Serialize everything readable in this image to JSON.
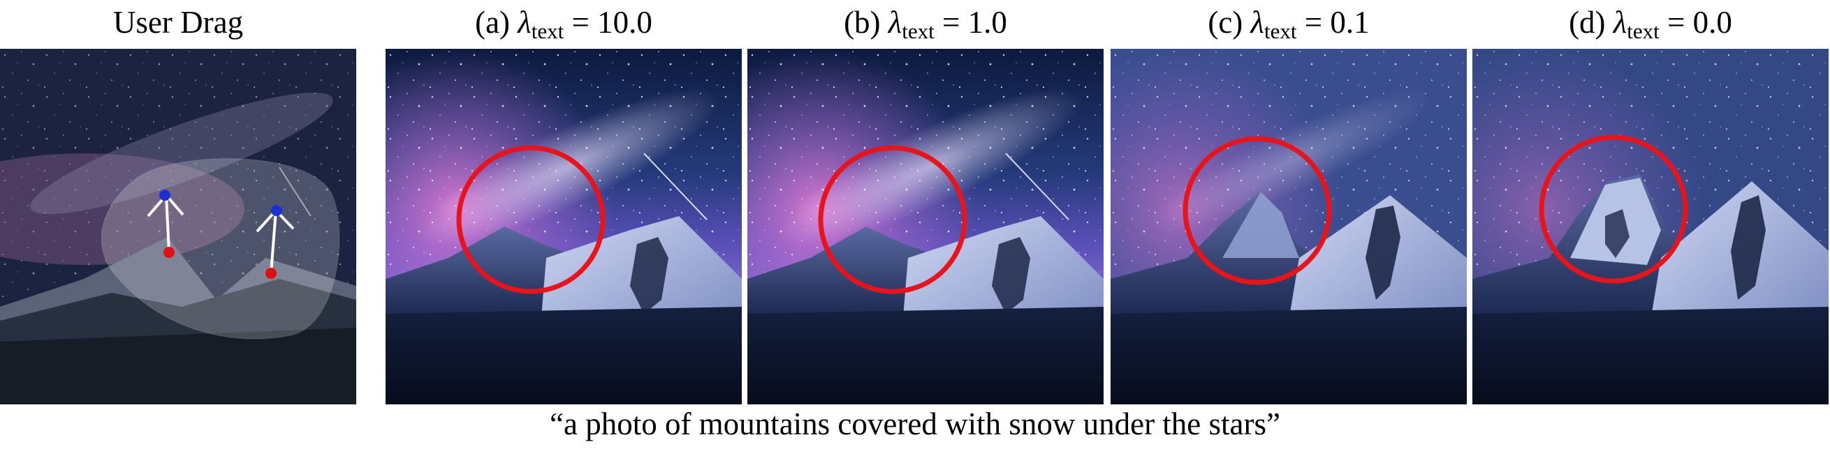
{
  "figure": {
    "user_drag_label": "User Drag",
    "panels": [
      {
        "prefix": "(a)",
        "symbol": "λ",
        "subscript": "text",
        "value": "= 10.0"
      },
      {
        "prefix": "(b)",
        "symbol": "λ",
        "subscript": "text",
        "value": "= 1.0"
      },
      {
        "prefix": "(c)",
        "symbol": "λ",
        "subscript": "text",
        "value": "= 0.1"
      },
      {
        "prefix": "(d)",
        "symbol": "λ",
        "subscript": "text",
        "value": "= 0.0"
      }
    ],
    "caption": "“a photo of mountains covered with snow under the stars”",
    "colors": {
      "highlight_circle": "#e8141b",
      "handle_point": "#1a2fd6",
      "target_point": "#e01010",
      "drag_arrow": "#ffffff"
    }
  }
}
